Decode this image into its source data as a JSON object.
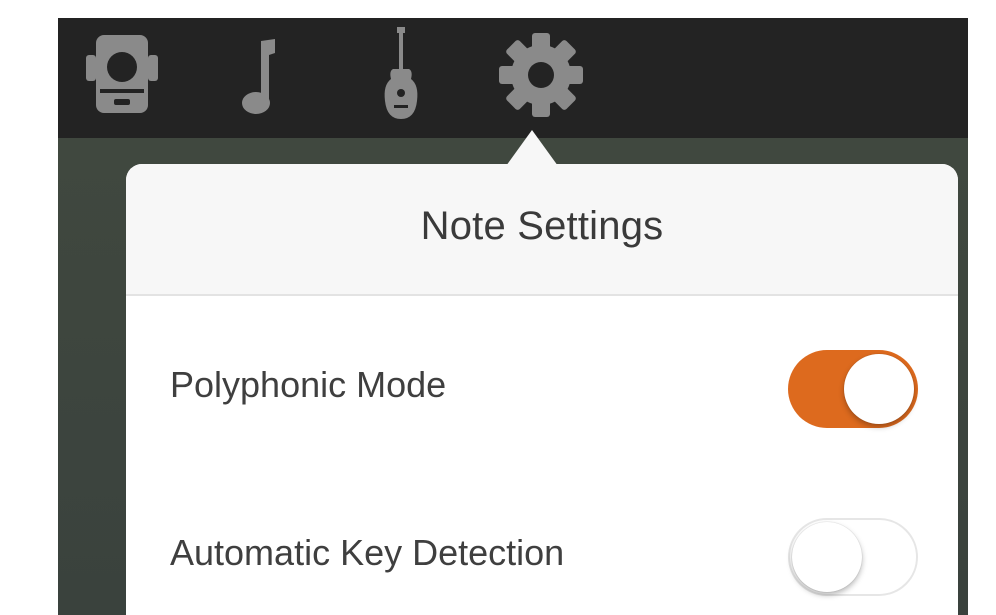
{
  "toolbar": {
    "icons": [
      "camera-device-icon",
      "music-note-icon",
      "guitar-icon",
      "gear-icon"
    ],
    "active_icon": "gear-icon",
    "icon_color": "#8a8a8a"
  },
  "popover": {
    "title": "Note Settings",
    "settings": [
      {
        "label": "Polyphonic Mode",
        "enabled": true
      },
      {
        "label": "Automatic Key Detection",
        "enabled": false
      }
    ]
  },
  "colors": {
    "toolbar_bg": "#232323",
    "backdrop_bg": "#3d4440",
    "accent": "#dd6a1e",
    "header_bg": "#f7f7f7"
  }
}
